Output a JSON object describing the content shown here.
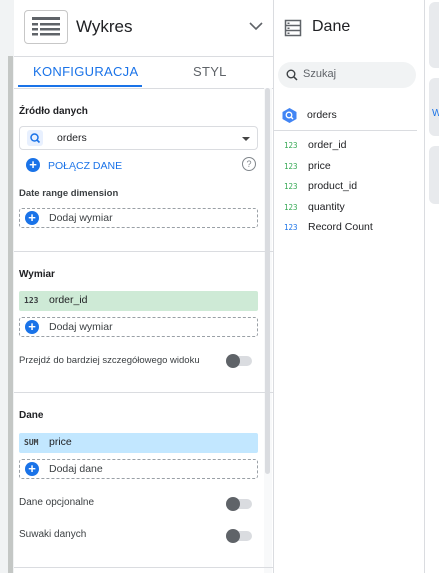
{
  "chart_panel": {
    "header_title": "Wykres",
    "tabs": [
      {
        "label": "KONFIGURACJA",
        "active": true
      },
      {
        "label": "STYL",
        "active": false
      }
    ],
    "data_source_section": {
      "title": "Źródło danych",
      "selected_source": "orders",
      "add_data_link": "POŁĄCZ DANE",
      "help_icon": "help-icon"
    },
    "date_range": {
      "label": "Date range dimension",
      "add_label": "Dodaj wymiar"
    },
    "dimension": {
      "title": "Wymiar",
      "chip_tag": "123",
      "chip_label": "order_id",
      "add_label": "Dodaj wymiar",
      "drill_label": "Przejdź do bardziej szczegółowego widoku"
    },
    "metric": {
      "title": "Dane",
      "chip_tag": "SUM",
      "chip_label": "price",
      "add_label": "Dodaj dane",
      "optional_label": "Dane opcjonalne",
      "sliders_label": "Suwaki danych"
    }
  },
  "data_panel": {
    "title": "Dane",
    "search_placeholder": "Szukaj",
    "source_name": "orders",
    "fields": [
      {
        "tag": "123",
        "name": "order_id",
        "color": "#34a853"
      },
      {
        "tag": "123",
        "name": "price",
        "color": "#34a853"
      },
      {
        "tag": "123",
        "name": "product_id",
        "color": "#34a853"
      },
      {
        "tag": "123",
        "name": "quantity",
        "color": "#34a853"
      },
      {
        "tag": "123",
        "name": "Record Count",
        "color": "#1a73e8"
      }
    ]
  },
  "right_edge": {
    "partial_letter": "W"
  },
  "colors": {
    "accent": "#1a73e8",
    "dimension_chip": "#ceead6",
    "metric_chip": "#c2e7ff",
    "divider": "#dadce0"
  }
}
